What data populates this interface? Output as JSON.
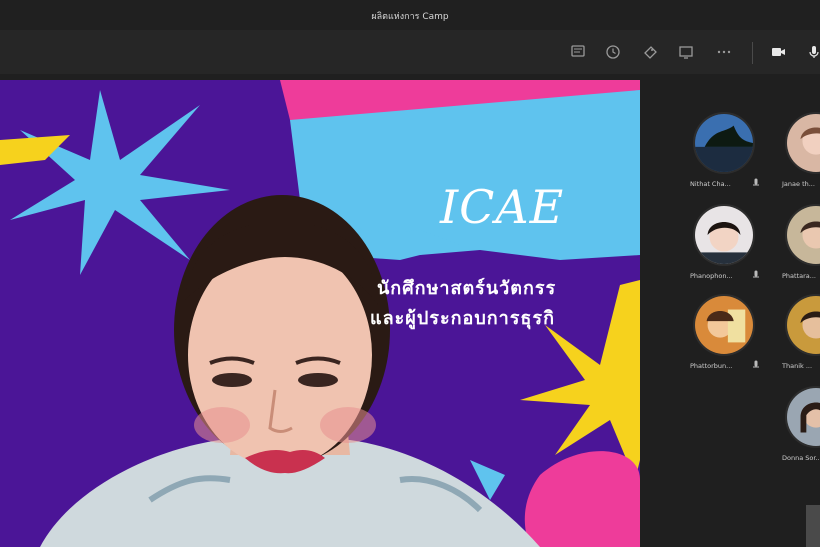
{
  "window": {
    "title": "ผลิตแห่งการ Camp"
  },
  "toolbar": {
    "buttons": [
      {
        "name": "chat-icon"
      },
      {
        "name": "clock-icon"
      },
      {
        "name": "reactions-icon"
      },
      {
        "name": "share-screen-icon"
      },
      {
        "name": "more-icon"
      },
      {
        "name": "camera-icon"
      },
      {
        "name": "mic-icon"
      }
    ]
  },
  "presentation": {
    "brand": "ICAE",
    "line1": "นักศึกษาสตร์นวัตกรร",
    "line2": "และผู้ประกอบการธุรกิ",
    "colors": {
      "purple": "#4b1597",
      "cyan": "#5fc3ee",
      "pink": "#ee3c9a",
      "yellow": "#f6d21d"
    }
  },
  "participants": [
    {
      "name": "Nithat Cha...",
      "avatar": "landscape"
    },
    {
      "name": "Janae th...",
      "avatar": "face"
    },
    {
      "name": "Phanophon...",
      "avatar": "face"
    },
    {
      "name": "Phattara...",
      "avatar": "face"
    },
    {
      "name": "Phattorbun...",
      "avatar": "photo"
    },
    {
      "name": "Thanik ...",
      "avatar": "face"
    },
    {
      "name": "Donna Sor...",
      "avatar": "face"
    }
  ]
}
